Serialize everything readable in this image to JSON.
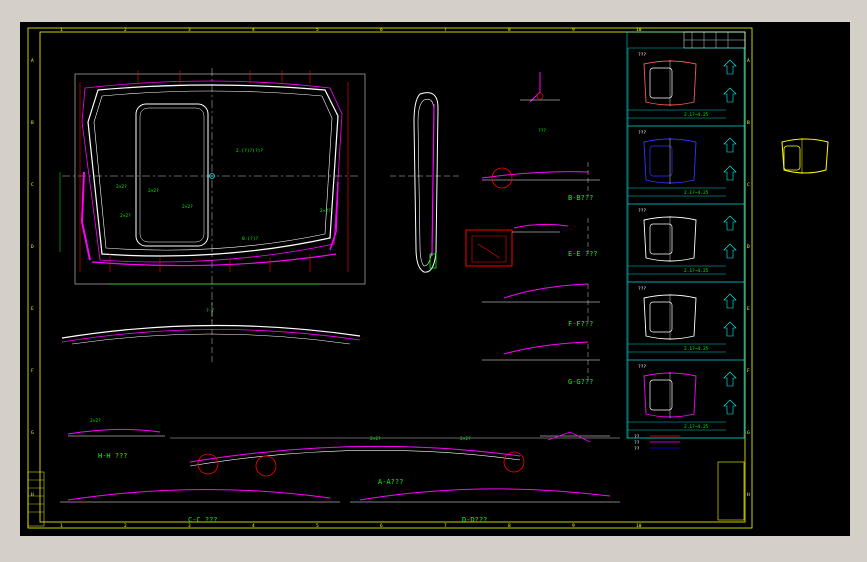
{
  "colors": {
    "background": "#000000",
    "frame": "#ffff00",
    "outline": "#ffffff",
    "contour": "#ff00ff",
    "dimension": "#00ff00",
    "centerline": "#ffffff",
    "section": "#ff0000",
    "detail": "#00ffff",
    "blue": "#3333ff",
    "title_area": "#aaaaaa"
  },
  "grid_numbers": [
    "1",
    "2",
    "3",
    "4",
    "5",
    "6",
    "7",
    "8",
    "9",
    "10"
  ],
  "grid_letters": [
    "A",
    "B",
    "C",
    "D",
    "E",
    "F",
    "G",
    "H"
  ],
  "section_views": {
    "b": "B-B???",
    "e": "E-E ???",
    "f": "F-F???",
    "g": "G-G???",
    "h": "H-H ???",
    "a": "A-A???",
    "c": "C-C ???",
    "d": "D-D???"
  },
  "callouts": [
    "2×2?",
    "2×2?",
    "2×2?",
    "2×2?",
    "2×2?",
    "2×2?",
    "2×2?",
    "2×2?"
  ],
  "notes": {
    "note_top": "2.(?)?(?)?",
    "note_mid": "0.(?)?",
    "note_center": "?-?",
    "note_right": "???"
  },
  "sidebar_panels": [
    {
      "title": "???",
      "code": "2.1?~4.25"
    },
    {
      "title": "???",
      "code": "2.1?~4.25"
    },
    {
      "title": "???",
      "code": "2.1?~4.25"
    },
    {
      "title": "???",
      "code": "2.1?~4.25"
    },
    {
      "title": "???",
      "code": "2.1?~4.25"
    }
  ],
  "legend_items": [
    "??",
    "??",
    "??"
  ]
}
